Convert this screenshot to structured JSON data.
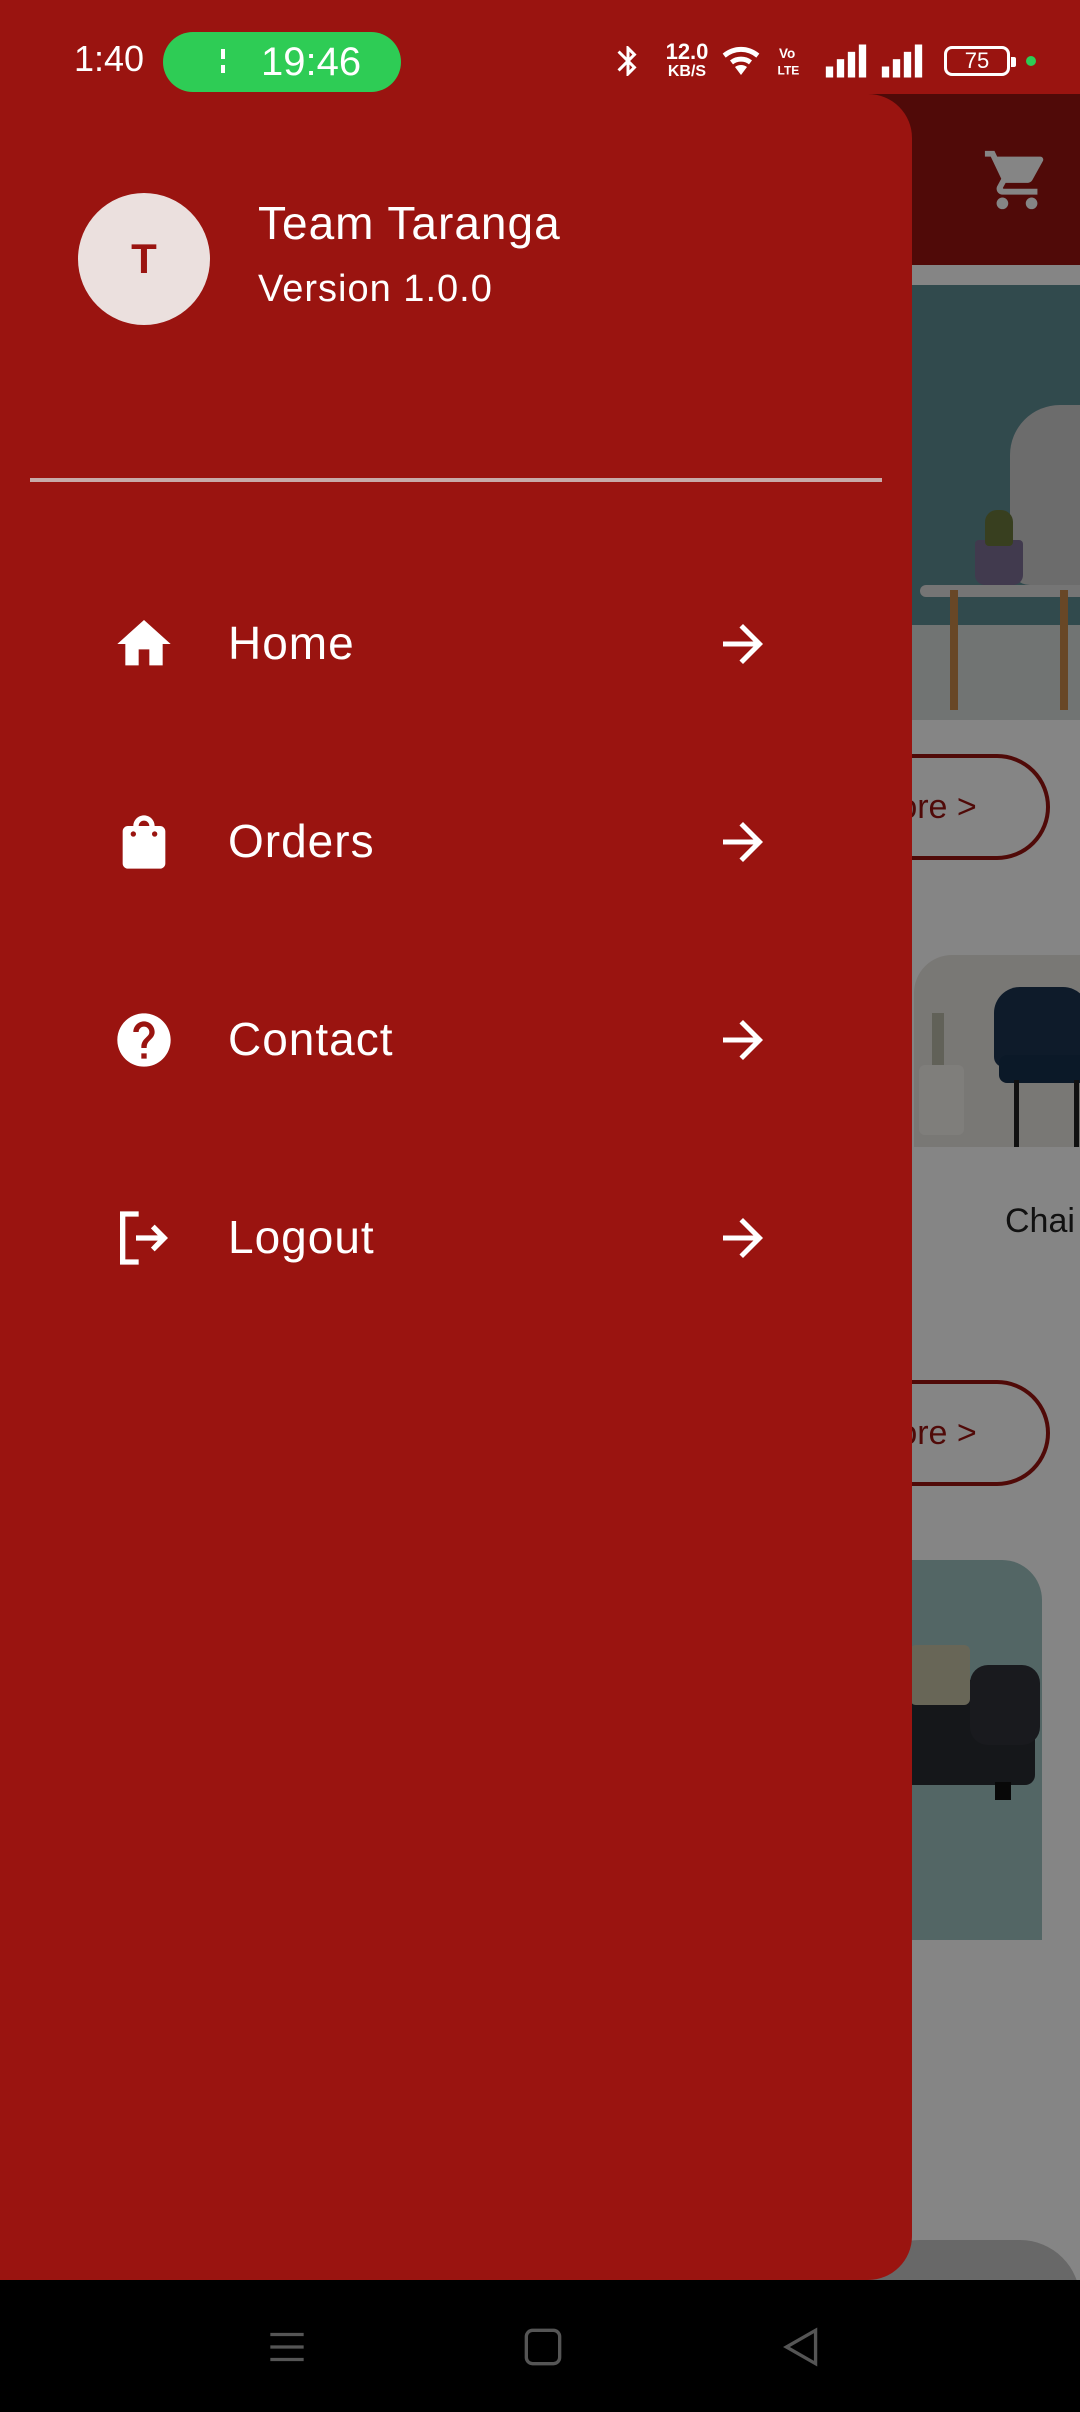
{
  "status_bar": {
    "time": "1:40",
    "call_timer": "19:46",
    "data_speed": "12.0",
    "data_unit": "KB/S",
    "battery_level": "75",
    "call_pill_color": "#2ecc55"
  },
  "background_app": {
    "cart_icon": "cart-icon",
    "more_button_1": "More >",
    "more_button_2": "More >",
    "product_label": "Chai"
  },
  "drawer": {
    "background_color": "#9a1410",
    "header": {
      "avatar_initial": "T",
      "name": "Team Taranga",
      "version": "Version 1.0.0"
    },
    "items": [
      {
        "label": "Home",
        "icon": "home-icon",
        "arrow": "arrow-right-icon"
      },
      {
        "label": "Orders",
        "icon": "shopping-bag-icon",
        "arrow": "arrow-right-icon"
      },
      {
        "label": "Contact",
        "icon": "help-circle-icon",
        "arrow": "arrow-right-icon"
      },
      {
        "label": "Logout",
        "icon": "logout-icon",
        "arrow": "arrow-right-icon"
      }
    ]
  },
  "nav_bar": {
    "buttons": [
      "menu-icon",
      "home-square-icon",
      "back-triangle-icon"
    ]
  }
}
